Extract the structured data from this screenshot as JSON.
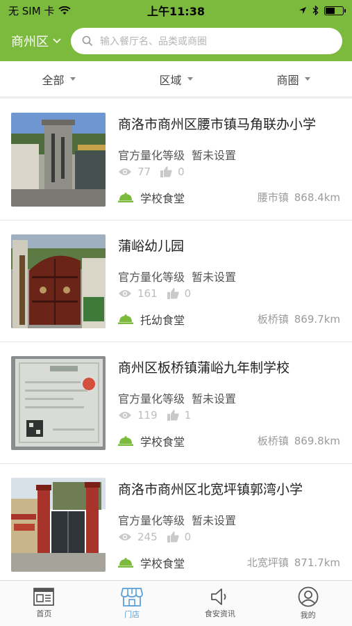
{
  "status_bar": {
    "carrier": "无 SIM 卡",
    "time": "上午11:38",
    "battery_level": 0.55
  },
  "header": {
    "district": "商州区",
    "search_placeholder": "输入餐厅名、品类或商圈"
  },
  "filters": [
    {
      "label": "全部"
    },
    {
      "label": "区域"
    },
    {
      "label": "商圈"
    }
  ],
  "items": [
    {
      "name": "商洛市商州区腰市镇马角联办小学",
      "grade_label": "官方量化等级",
      "grade_value": "暂未设置",
      "views": "77",
      "likes": "0",
      "type": "学校食堂",
      "town": "腰市镇",
      "distance": "868.4km",
      "icon_color": "#7cba3d"
    },
    {
      "name": "蒲峪幼儿园",
      "grade_label": "官方量化等级",
      "grade_value": "暂未设置",
      "views": "161",
      "likes": "0",
      "type": "托幼食堂",
      "town": "板桥镇",
      "distance": "869.7km",
      "icon_color": "#7cba3d"
    },
    {
      "name": "商州区板桥镇蒲峪九年制学校",
      "grade_label": "官方量化等级",
      "grade_value": "暂未设置",
      "views": "119",
      "likes": "1",
      "type": "学校食堂",
      "town": "板桥镇",
      "distance": "869.8km",
      "icon_color": "#7cba3d"
    },
    {
      "name": "商洛市商州区北宽坪镇郭湾小学",
      "grade_label": "官方量化等级",
      "grade_value": "暂未设置",
      "views": "245",
      "likes": "0",
      "type": "学校食堂",
      "town": "北宽坪镇",
      "distance": "871.7km",
      "icon_color": "#7cba3d"
    }
  ],
  "tabs": [
    {
      "label": "首页",
      "icon": "home-icon",
      "active": false
    },
    {
      "label": "门店",
      "icon": "store-icon",
      "active": true
    },
    {
      "label": "食安资讯",
      "icon": "speaker-icon",
      "active": false
    },
    {
      "label": "我的",
      "icon": "user-icon",
      "active": false
    }
  ],
  "colors": {
    "brand": "#7cba3d",
    "active_tab": "#5a9fd8"
  }
}
